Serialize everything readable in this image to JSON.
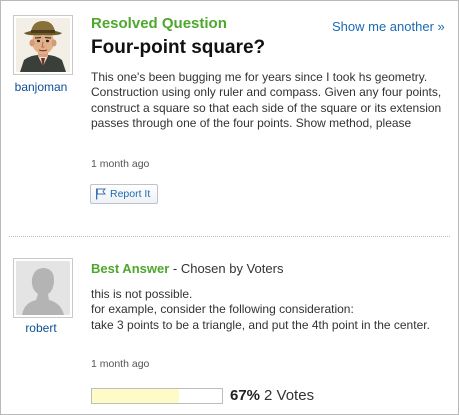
{
  "question": {
    "status": "Resolved Question",
    "show_another": "Show me another »",
    "title": "Four-point square?",
    "body": "This one's been bugging me for years since I took hs geometry. Construction using only ruler and compass. Given any four points, construct a square so that each side of the square or its extension passes through one of the four points. Show method, please",
    "timestamp": "1 month ago",
    "report_label": "Report It",
    "asker": {
      "username": "banjoman",
      "avatar_icon": "cartoon-man-avatar-icon"
    }
  },
  "answer": {
    "heading": "Best Answer",
    "chosen_by": " - Chosen by Voters",
    "body_lines": [
      "this is not possible.",
      "for example, consider the following consideration:",
      "take 3 points to be a triangle, and put the 4th point in the center."
    ],
    "timestamp": "1 month ago",
    "answerer": {
      "username": "robert",
      "avatar_icon": "default-silhouette-avatar-icon"
    },
    "vote_percent_label": "67%",
    "vote_fraction": 0.67,
    "votes_label": "2 Votes"
  },
  "colors": {
    "status_green": "#4ea72e",
    "link_blue": "#1a6bb3",
    "vote_fill": "#fffbc6"
  }
}
